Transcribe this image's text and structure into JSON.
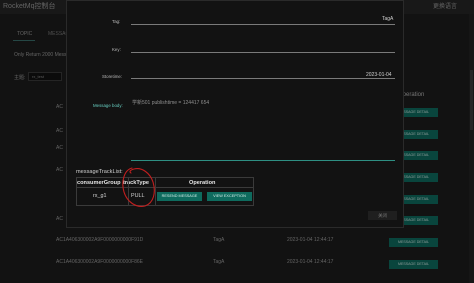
{
  "app": {
    "title": "RocketMq控制台",
    "language_menu": "更换语言"
  },
  "tabs": [
    {
      "label": "TOPIC"
    },
    {
      "label": "MESSAGE"
    }
  ],
  "notice": "Only Return 2000 Messages",
  "filter": {
    "topic_label": "主题:",
    "topic_value": "rx_test"
  },
  "table": {
    "operation_header": "Operation",
    "detail_button": "MESSAGE DETAIL",
    "rows": [
      {
        "id": "AC",
        "tag": "",
        "time": ""
      },
      {
        "id": "AC",
        "tag": "",
        "time": ""
      },
      {
        "id": "AC",
        "tag": "",
        "time": ""
      },
      {
        "id": "AC",
        "tag": "",
        "time": ""
      },
      {
        "id": "AC",
        "tag": "",
        "time": ""
      },
      {
        "id": "AC",
        "tag": "",
        "time": ""
      },
      {
        "id": "AC1A406300002A9F0000000000F91D",
        "tag": "TagA",
        "time": "2023-01-04 12:44:17"
      },
      {
        "id": "AC1A406300002A9F0000000000F86E",
        "tag": "TagA",
        "time": "2023-01-04 12:44:17"
      }
    ]
  },
  "modal": {
    "tag_label": "Tag:",
    "tag_value": "TagA",
    "key_label": "Key:",
    "key_value": "",
    "storetime_label": "Storetime:",
    "storetime_value": "2023-01-04",
    "body_label": "Message body:",
    "body_value": "学新501 publishtime = 124417 654",
    "tracklist_label": "messageTrackList:",
    "track_headers": {
      "group": "consumerGroup",
      "type": "trackType",
      "operation": "Operation"
    },
    "track_rows": [
      {
        "group": "rx_g1",
        "type": "PULL"
      }
    ],
    "resend_button": "RESEND MESSAGE",
    "exception_button": "VIEW EXCEPTION",
    "close_button": "关闭"
  },
  "colors": {
    "accent": "#0e6b5e",
    "annotation": "#c21f1f"
  }
}
